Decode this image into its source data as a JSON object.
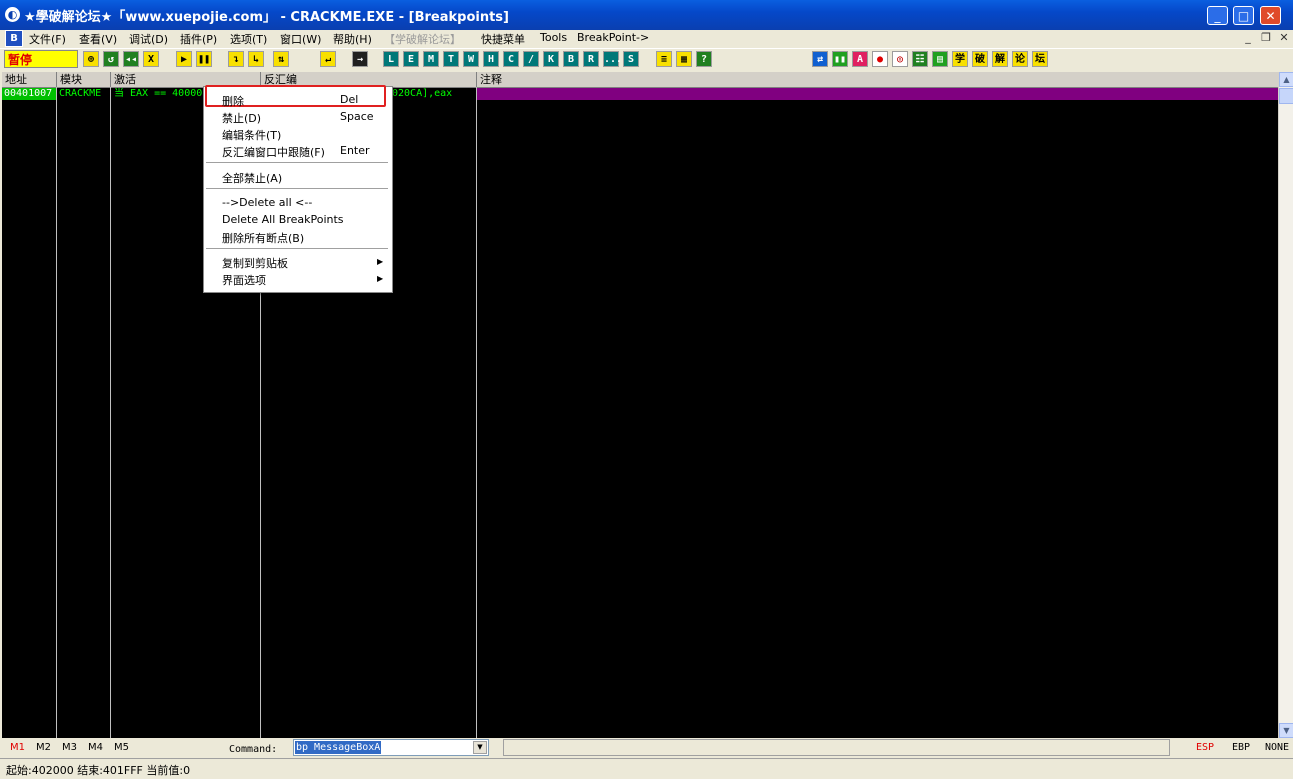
{
  "window": {
    "title": "★學破解论坛★「www.xuepojie.com」 - CRACKME.EXE - [Breakpoints]",
    "min": "_",
    "max": "□",
    "close": "✕"
  },
  "menu": {
    "items": [
      "文件(F)",
      "查看(V)",
      "调试(D)",
      "插件(P)",
      "选项(T)",
      "窗口(W)",
      "帮助(H)",
      "【学破解论坛】",
      "快捷菜单",
      "Tools",
      "BreakPoint->"
    ]
  },
  "toolbar": {
    "status": "暂停",
    "buttons_a": [
      "⊕",
      "↺",
      "◂◂",
      "X"
    ],
    "buttons_b": [
      "▶",
      "❚❚"
    ],
    "buttons_c": [
      "↴",
      "↳",
      "⇅",
      "↵",
      "→"
    ],
    "letters": [
      "L",
      "E",
      "M",
      "T",
      "W",
      "H",
      "C",
      "/",
      "K",
      "B",
      "R",
      "...",
      "S"
    ],
    "buttons_d": [
      "≡",
      "▦",
      "?"
    ],
    "right_tools": [
      "⇄",
      "▮▮",
      "A",
      "●",
      "◎",
      "☷",
      "▤"
    ],
    "right_chars": [
      "学",
      "破",
      "解",
      "论",
      "坛"
    ]
  },
  "pane": {
    "headers": [
      "地址",
      "模块",
      "激活",
      "反汇编",
      "注释"
    ],
    "row": {
      "address": "00401007",
      "module": "CRACKME",
      "active": "当 EAX == 40000",
      "disasm": "020CA],eax",
      "comment": ""
    }
  },
  "context_menu": {
    "items": [
      {
        "label": "删除",
        "shortcut": "Del"
      },
      {
        "label": "禁止(D)",
        "shortcut": "Space"
      },
      {
        "label": "编辑条件(T)",
        "shortcut": ""
      },
      {
        "label": "反汇编窗口中跟随(F)",
        "shortcut": "Enter"
      },
      {
        "label": "全部禁止(A)",
        "shortcut": ""
      },
      {
        "label": "-->Delete all <--",
        "shortcut": ""
      },
      {
        "label": "Delete All BreakPoints",
        "shortcut": ""
      },
      {
        "label": "删除所有断点(B)",
        "shortcut": ""
      },
      {
        "label": "复制到剪贴板",
        "shortcut": ""
      },
      {
        "label": "界面选项",
        "shortcut": ""
      }
    ]
  },
  "command_bar": {
    "markers": [
      "M1",
      "M2",
      "M3",
      "M4",
      "M5"
    ],
    "label": "Command:",
    "value": "bp MessageBoxA",
    "regs": [
      "ESP",
      "EBP",
      "NONE"
    ]
  },
  "status_bar": {
    "text": "起始:402000 结束:401FFF 当前值:0"
  }
}
